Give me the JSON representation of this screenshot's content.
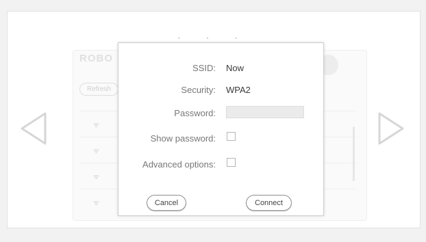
{
  "background": {
    "title": "ROBO",
    "refresh_label": "Refresh",
    "rows": [
      {
        "icon": "wifi-icon"
      },
      {
        "icon": "wifi-icon"
      },
      {
        "icon": "wifi-icon"
      },
      {
        "icon": "wifi-icon"
      }
    ]
  },
  "pager_dots": "• • •",
  "dialog": {
    "ssid_label": "SSID:",
    "ssid_value": "Now",
    "security_label": "Security:",
    "security_value": "WPA2",
    "password_label": "Password:",
    "password_value": "",
    "show_password_label": "Show password:",
    "advanced_label": "Advanced options:",
    "cancel_label": "Cancel",
    "connect_label": "Connect"
  },
  "colors": {
    "accent": "#8c8c8c",
    "dialog_border": "#cdcdcd"
  }
}
